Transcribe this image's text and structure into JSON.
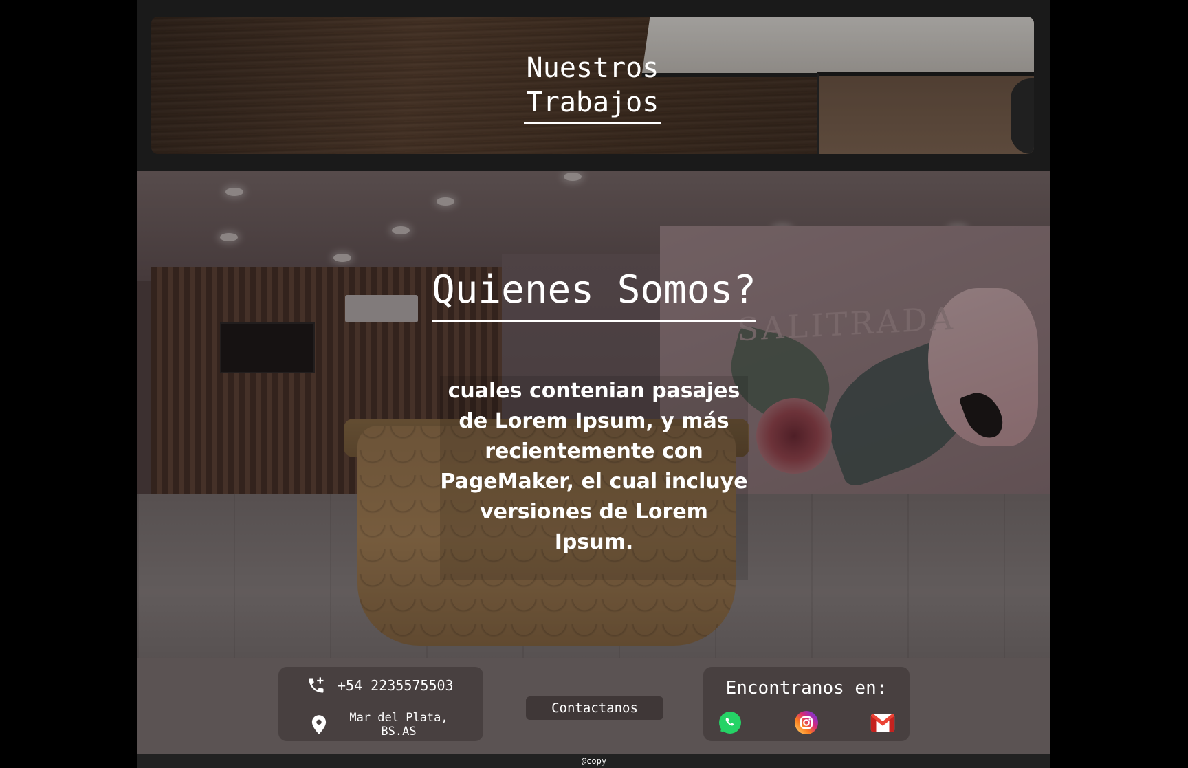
{
  "banner": {
    "title_line1": "Nuestros",
    "title_line2": "Trabajos"
  },
  "about": {
    "title": "Quienes Somos?",
    "text": "cuales contenian pasajes de Lorem Ipsum, y más recientemente con PageMaker, el cual incluye versiones de Lorem Ipsum.",
    "wall_sign": "SALITRADA"
  },
  "footer": {
    "phone": "+54 2235575503",
    "location_line1": "Mar del Plata,",
    "location_line2": "BS.AS",
    "contact_button": "Contactanos",
    "social_title": "Encontranos en:",
    "icons": [
      "phone-icon",
      "location-pin-icon",
      "whatsapp-icon",
      "instagram-icon",
      "gmail-icon"
    ],
    "copyright": "@copy"
  },
  "colors": {
    "background": "#000000",
    "panel": "#1a1a1a",
    "whatsapp": "#25D366",
    "gmail_red": "#EA4335"
  }
}
